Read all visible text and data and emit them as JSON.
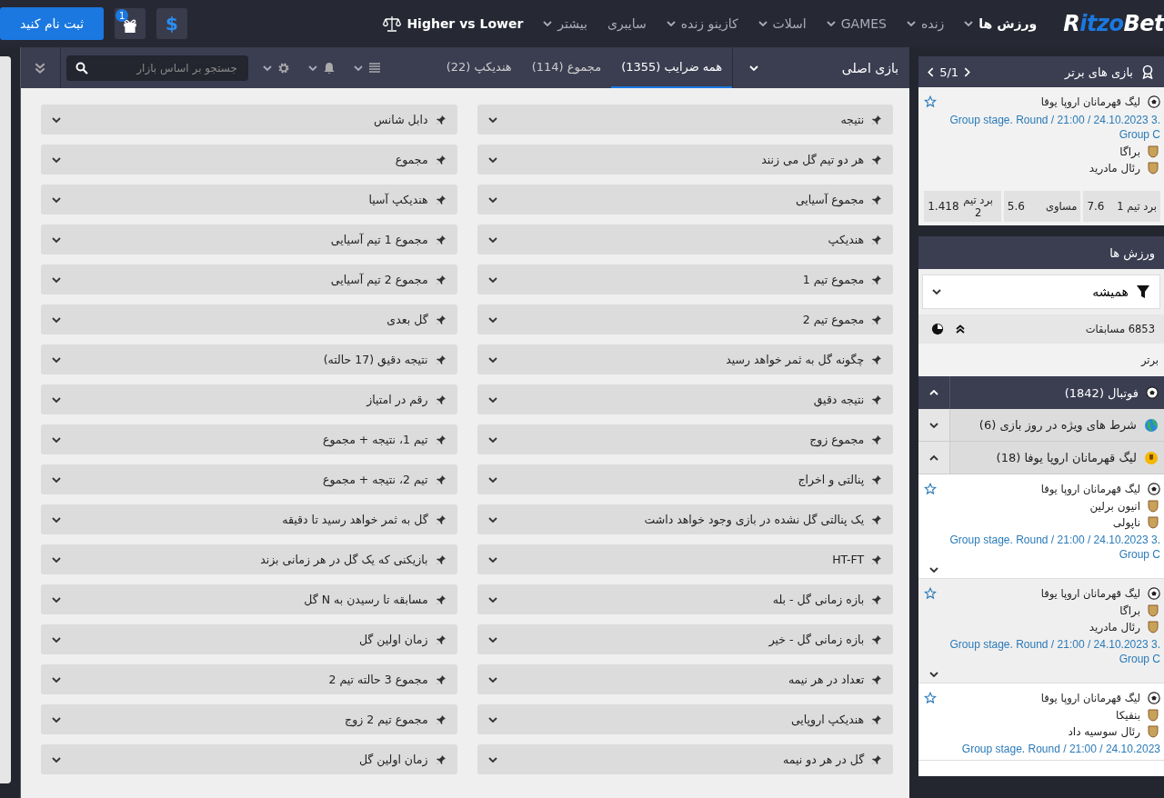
{
  "header": {
    "logo": {
      "first": "R",
      "rest": "itzo",
      "last": "Bet"
    },
    "nav": [
      {
        "label": "ورزش ها",
        "dropdown": true,
        "selected": true
      },
      {
        "label": "زنده",
        "dropdown": true,
        "selected": false
      },
      {
        "label": "GAMES",
        "dropdown": true,
        "selected": false
      },
      {
        "label": "اسلات",
        "dropdown": true,
        "selected": false
      },
      {
        "label": "کازینو زنده",
        "dropdown": true,
        "selected": false
      },
      {
        "label": "سایبری",
        "dropdown": false,
        "selected": false
      },
      {
        "label": "بیشتر",
        "dropdown": true,
        "selected": false
      }
    ],
    "promo": "Higher vs Lower",
    "gift_badge": "1",
    "currency": "$",
    "register_button": "ثبت نام کنید"
  },
  "toolbar": {
    "game_select": "بازی اصلی",
    "tabs": [
      {
        "label": "همه ضرایب (1355)",
        "selected": true
      },
      {
        "label": "مجموع (114)",
        "selected": false
      },
      {
        "label": "هندیکپ (22)",
        "selected": false
      }
    ],
    "search": {
      "placeholder": "جستجو بر اساس بازار"
    }
  },
  "markets": [
    "نتیجه",
    "دابل شانس",
    "هر دو تیم گل می زنند",
    "مجموع",
    "مجموع آسیایی",
    "هندیکپ آسیا",
    "هندیکپ",
    "مجموع 1 تیم آسیایی",
    "مجموع تیم 1",
    "مجموع 2 تیم آسیایی",
    "مجموع تیم 2",
    "گل بعدی",
    "چگونه گل به ثمر خواهد رسید",
    "نتیجه دقیق (17 حالته)",
    "نتیجه دقیق",
    "رقم در امتیاز",
    "مجموع زوج",
    "تیم 1، نتیجه + مجموع",
    "پنالتی و اخراج",
    "تیم 2، نتیجه + مجموع",
    "یک پنالتی گل نشده در بازی وجود خواهد داشت",
    "گل به ثمر خواهد رسید تا دقیقه",
    "HT-FT",
    "بازیکنی که یک گل در هر زمانی بزند",
    "بازه زمانی گل - بله",
    "مسابقه تا رسیدن به N گل",
    "بازه زمانی گل - خیر",
    "زمان اولین گل",
    "تعداد در هر نیمه",
    "مجموع 3 حالته  تیم 2",
    "هندیکپ اروپایی",
    "مجموع تیم 2 زوج",
    "گل در هر دو نیمه",
    "زمان اولین گل"
  ],
  "sidebar": {
    "top_games": {
      "title": "بازی های برتر",
      "pager": "5/1",
      "match": {
        "league": "لیگ قهرمانان اروپا یوفا",
        "info": "Group stage. Round / 21:00 / 24.10.2023 3. Group C",
        "teams": [
          "براگا",
          "رئال مادرید"
        ],
        "odds": [
          {
            "label": "برد تیم 1",
            "value": "7.6"
          },
          {
            "label": "مساوی",
            "value": "5.6"
          },
          {
            "label": "برد تیم 2",
            "value": "1.418"
          }
        ]
      }
    },
    "sports_title": "ورزش ها",
    "filter": "همیشه",
    "matches_count": "6853 مسابقات",
    "top_label": "برتر",
    "sport": {
      "label": "فوتبال (1842)",
      "expanded": true
    },
    "groups": [
      {
        "label": "شرط های ویژه در روز بازی (6)",
        "expanded": false
      },
      {
        "label": "لیگ قهرمانان اروپا یوفا (18)",
        "expanded": true
      }
    ],
    "events": [
      {
        "league": "لیگ قهرمانان اروپا یوفا",
        "teams": [
          "انیون برلین",
          "ناپولی"
        ],
        "info": "Group stage. Round / 21:00 / 24.10.2023 3. Group C"
      },
      {
        "league": "لیگ قهرمانان اروپا یوفا",
        "teams": [
          "براگا",
          "رئال مادرید"
        ],
        "info": "Group stage. Round / 21:00 / 24.10.2023 3. Group C"
      },
      {
        "league": "لیگ قهرمانان اروپا یوفا",
        "teams": [
          "بنفیکا",
          "رئال سوسیه داد"
        ],
        "info": "Group stage. Round / 21:00 / 24.10.2023"
      }
    ]
  }
}
